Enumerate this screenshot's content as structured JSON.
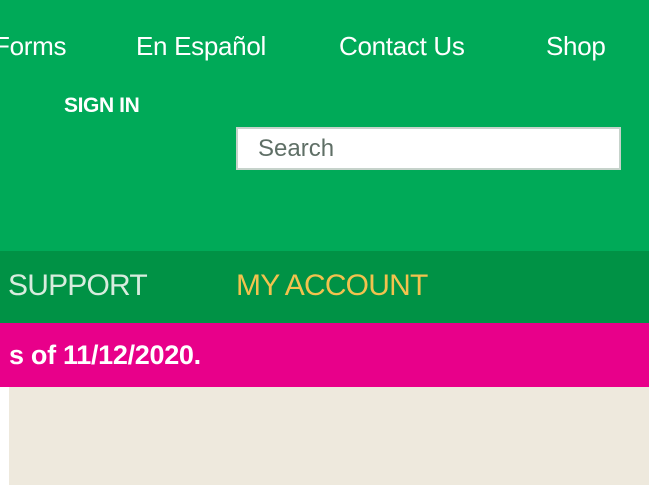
{
  "header": {
    "top_links": [
      {
        "label": "Forms"
      },
      {
        "label": "En Español"
      },
      {
        "label": "Contact Us"
      },
      {
        "label": "Shop"
      }
    ],
    "sign_in_label": "SIGN IN",
    "search": {
      "placeholder": "Search",
      "value": ""
    }
  },
  "nav": {
    "items": [
      {
        "label": "SUPPORT"
      },
      {
        "label": "MY ACCOUNT"
      }
    ]
  },
  "alert": {
    "text": "s of 11/12/2020."
  },
  "colors": {
    "header_green": "#00AA58",
    "nav_green": "#009245",
    "account_gold": "#F2C24E",
    "alert_magenta": "#E8008A",
    "content_beige": "#EEE9DD"
  }
}
